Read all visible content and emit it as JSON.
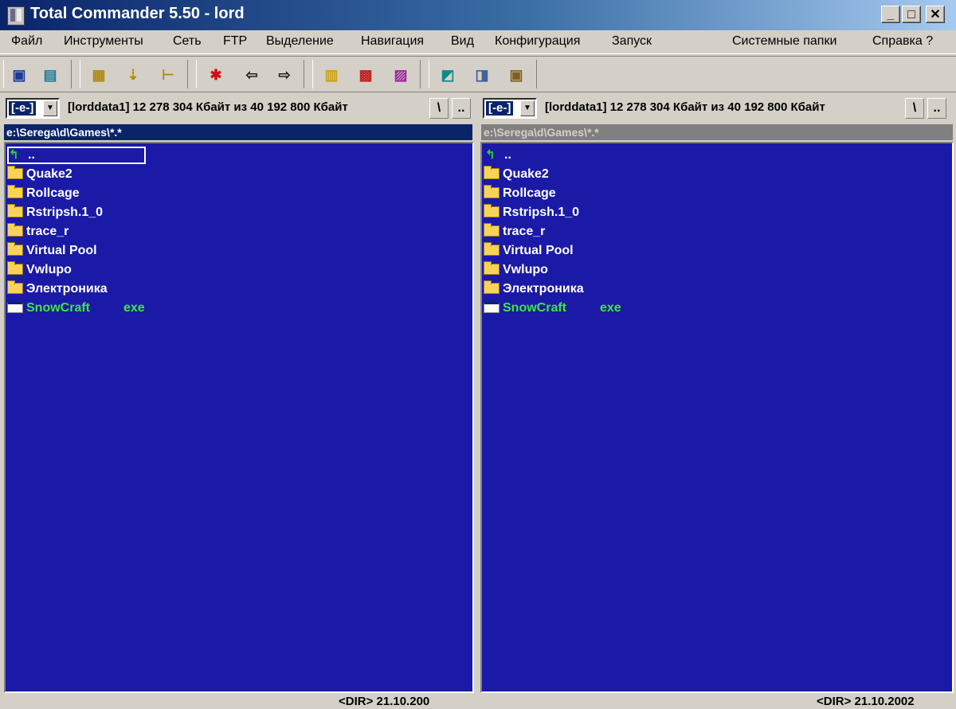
{
  "window": {
    "title": "Total Commander 5.50 - lord",
    "minimize": "_",
    "maximize": "□",
    "close": "✕"
  },
  "menu": [
    "Файл",
    "Инструменты",
    "Сеть",
    "FTP",
    "Выделение",
    "Навигация",
    "Вид",
    "Конфигурация",
    "Запуск",
    "Системные папки",
    "Справка ?"
  ],
  "toolbar_icons": [
    "save-icon",
    "compare-icon",
    "select-all-icon",
    "tree-icon",
    "folder-tree-icon",
    "star-icon",
    "back-arrow-icon",
    "forward-arrow-icon",
    "archive-icon",
    "ftp-icon",
    "url-icon",
    "edit-icon",
    "notepad-icon",
    "explorer-icon"
  ],
  "left": {
    "drive": "[-e-]",
    "info": "[lorddata1]  12 278 304 Кбайт из 40 192 800 Кбайт",
    "root_btn": "\\",
    "up_btn": "..",
    "path": "e:\\Serega\\d\\Games\\*.*",
    "status": "<DIR>    21.10.200"
  },
  "right": {
    "drive": "[-e-]",
    "info": "[lorddata1]  12 278 304 Кбайт из 40 192 800 Кбайт",
    "root_btn": "\\",
    "up_btn": "..",
    "path": "e:\\Serega\\d\\Games\\*.*",
    "status": "<DIR>    21.10.2002"
  },
  "files": {
    "up": "..",
    "folders": [
      "Quake2",
      "Rollcage",
      "Rstripsh.1_0",
      "trace_r",
      "Virtual Pool",
      "Vwlupo",
      "Электроника"
    ],
    "exe_name": "SnowCraft",
    "exe_ext": "exe"
  }
}
